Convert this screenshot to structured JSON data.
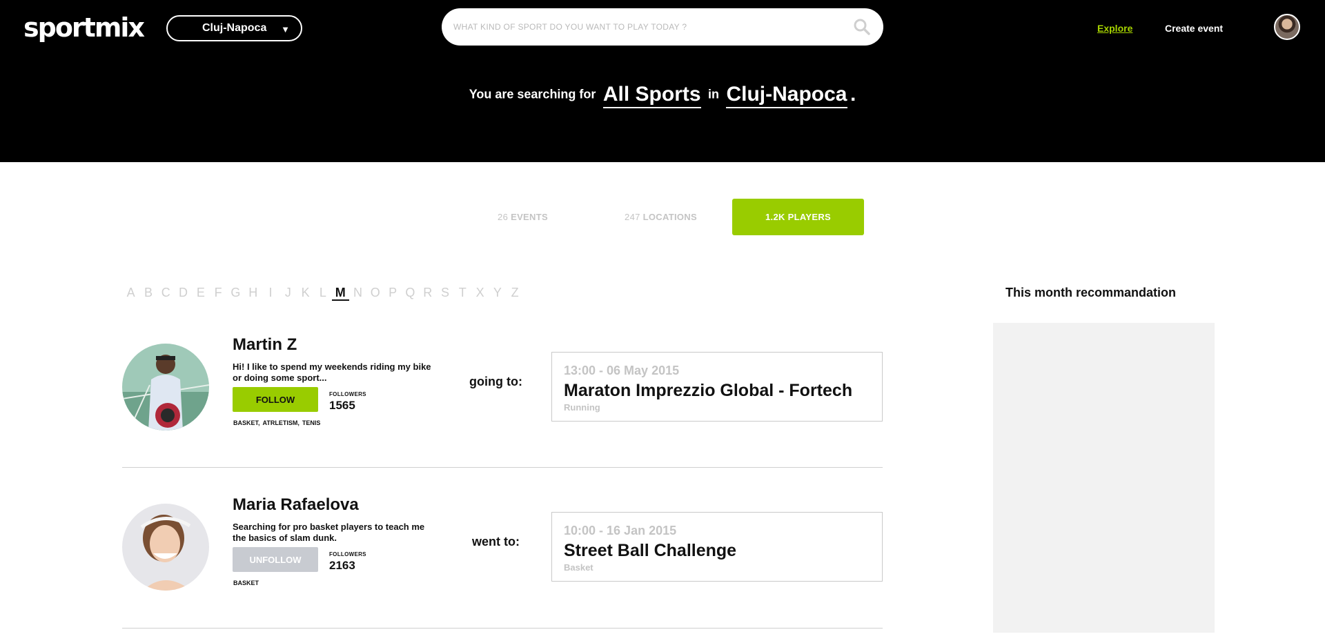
{
  "header": {
    "logo": "sportmix",
    "city": "Cluj-Napoca",
    "search_placeholder": "WHAT KIND OF SPORT DO YOU WANT TO PLAY TODAY ?",
    "nav": {
      "explore": "Explore",
      "create_event": "Create event"
    },
    "summary": {
      "prefix": "You are searching for",
      "sport": "All Sports",
      "connector": "in",
      "city": "Cluj-Napoca",
      "suffix": "."
    },
    "accent_color": "#99cc00"
  },
  "tabs": [
    {
      "count": "26",
      "label": "EVENTS",
      "active": false
    },
    {
      "count": "247",
      "label": "LOCATIONS",
      "active": false
    },
    {
      "count": "1.2K",
      "label": "PLAYERS",
      "active": true
    }
  ],
  "alphabet": {
    "letters": [
      "A",
      "B",
      "C",
      "D",
      "E",
      "F",
      "G",
      "H",
      "I",
      "J",
      "K",
      "L",
      "M",
      "N",
      "O",
      "P",
      "Q",
      "R",
      "S",
      "T",
      "X",
      "Y",
      "Z"
    ],
    "active": "M"
  },
  "players": [
    {
      "name": "Martin Z",
      "bio": "Hi! I like to spend my weekends riding my bike or doing some sport...",
      "button": "FOLLOW",
      "followers_label": "FOLLOWERS",
      "followers": "1565",
      "tags": [
        "BASKET,",
        "ATRLETISM,",
        "TENIS"
      ],
      "relation": "going to:",
      "event": {
        "time": "13:00 - 06 May 2015",
        "title": "Maraton Imprezzio Global - Fortech",
        "sport": "Running"
      }
    },
    {
      "name": "Maria Rafaelova",
      "bio": "Searching for pro basket  players to teach me the basics of slam dunk.",
      "button": "UNFOLLOW",
      "followers_label": "FOLLOWERS",
      "followers": "2163",
      "tags": [
        "BASKET"
      ],
      "relation": "went to:",
      "event": {
        "time": "10:00 - 16 Jan 2015",
        "title": "Street Ball Challenge",
        "sport": "Basket"
      }
    }
  ],
  "sidebar": {
    "title": "This month recommandation"
  }
}
